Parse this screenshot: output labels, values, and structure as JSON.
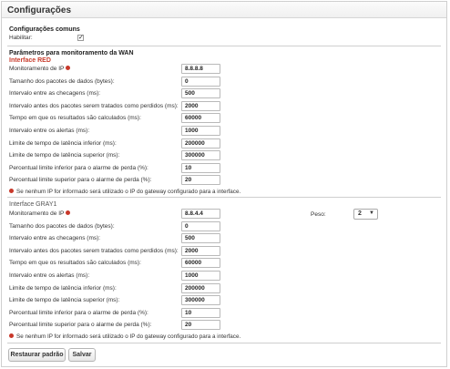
{
  "title": "Configurações",
  "common": {
    "heading": "Configurações comuns",
    "enable_label": "Habilitar:",
    "enable_checked": true
  },
  "wan": {
    "heading": "Parâmetros para monitoramento da WAN"
  },
  "red": {
    "heading": "Interface RED",
    "rows": [
      {
        "label": "Monitoramento de IP",
        "value": "8.8.8.8"
      },
      {
        "label": "Tamanho dos pacotes de dados (bytes):",
        "value": "0"
      },
      {
        "label": "Intervalo entre as checagens (ms):",
        "value": "500"
      },
      {
        "label": "Intervalo antes dos pacotes serem tratados como perdidos (ms):",
        "value": "2000"
      },
      {
        "label": "Tempo em que os resultados são calculados (ms):",
        "value": "60000"
      },
      {
        "label": "Intervalo entre os alertas (ms):",
        "value": "1000"
      },
      {
        "label": "Limite de tempo de latência inferior (ms):",
        "value": "200000"
      },
      {
        "label": "Limite de tempo de latência superior (ms):",
        "value": "300000"
      },
      {
        "label": "Percentual limite inferior para o alarme de perda (%):",
        "value": "10"
      },
      {
        "label": "Percentual limite superior para o alarme de perda (%):",
        "value": "20"
      }
    ],
    "note": "Se nenhum IP for informado será utilizado o IP do gateway configurado para a interface."
  },
  "gray": {
    "heading": "Interface GRAY1",
    "weight_label": "Peso:",
    "weight_value": "2",
    "rows": [
      {
        "label": "Monitoramento de IP",
        "value": "8.8.4.4"
      },
      {
        "label": "Tamanho dos pacotes de dados (bytes):",
        "value": "0"
      },
      {
        "label": "Intervalo entre as checagens (ms):",
        "value": "500"
      },
      {
        "label": "Intervalo antes dos pacotes serem tratados como perdidos (ms):",
        "value": "2000"
      },
      {
        "label": "Tempo em que os resultados são calculados (ms):",
        "value": "60000"
      },
      {
        "label": "Intervalo entre os alertas (ms):",
        "value": "1000"
      },
      {
        "label": "Limite de tempo de latência inferior (ms):",
        "value": "200000"
      },
      {
        "label": "Limite de tempo de latência superior (ms):",
        "value": "300000"
      },
      {
        "label": "Percentual limite inferior para o alarme de perda (%):",
        "value": "10"
      },
      {
        "label": "Percentual limite superior para o alarme de perda (%):",
        "value": "20"
      }
    ],
    "note": "Se nenhum IP for informado será utilizado o IP do gateway configurado para a interface."
  },
  "buttons": {
    "restore": "Restaurar padrão",
    "save": "Salvar"
  },
  "colors": {
    "accent_red": "#c83c2c",
    "info_icon": "#c8382a"
  },
  "icons": {
    "info": "info-icon",
    "checkbox": "checkmark-icon",
    "select_arrow": "caret-down-icon"
  }
}
